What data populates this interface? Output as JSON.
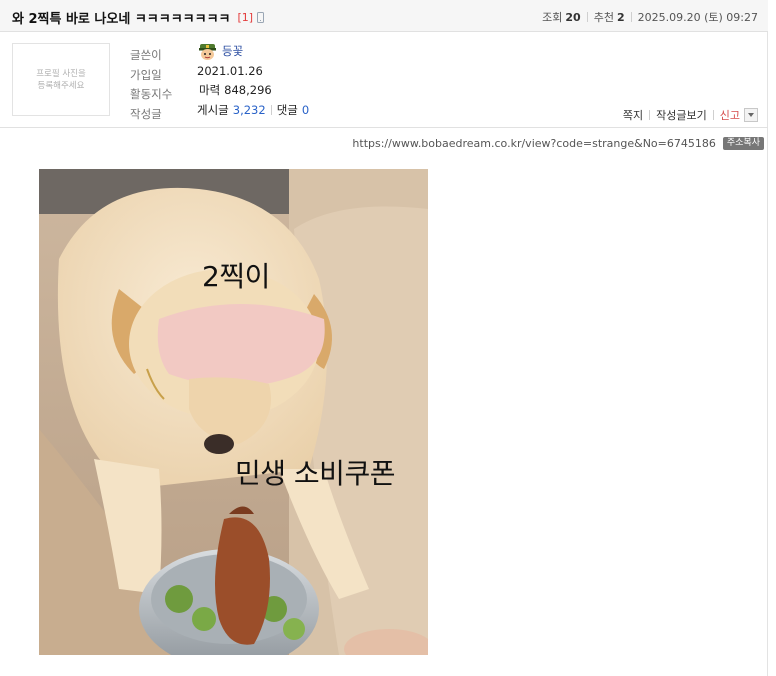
{
  "post": {
    "title": "와 2찍특 바로 나오네 ㅋㅋㅋㅋㅋㅋㅋㅋ",
    "comment_count": "[1]",
    "views_label": "조회",
    "views": "20",
    "recommend_label": "추천",
    "recommend": "2",
    "date": "2025.09.20 (토) 09:27"
  },
  "profile": {
    "photo_placeholder_line1": "프로필 사진을",
    "photo_placeholder_line2": "등록해주세요",
    "labels": {
      "author": "글쓴이",
      "joined": "가입일",
      "activity": "활동지수",
      "posts": "작성글"
    },
    "nickname": "등꽃",
    "joined_date": "2021.01.26",
    "power_label": "마력",
    "power_value": "848,296",
    "posts_label": "게시글",
    "posts_count": "3,232",
    "comments_label": "댓글",
    "comments_count": "0"
  },
  "actions": {
    "message": "쪽지",
    "view_posts": "작성글보기",
    "report": "신고"
  },
  "url": {
    "text": "https://www.bobaedream.co.kr/view?code=strange&No=6745186",
    "copy_label": "주소복사"
  },
  "image": {
    "caption_top": "2찍이",
    "caption_bottom": "민생 소비쿠폰"
  },
  "colors": {
    "accent_blue": "#2962c8",
    "report_red": "#d64b4b",
    "comment_red": "#e33c3c"
  }
}
